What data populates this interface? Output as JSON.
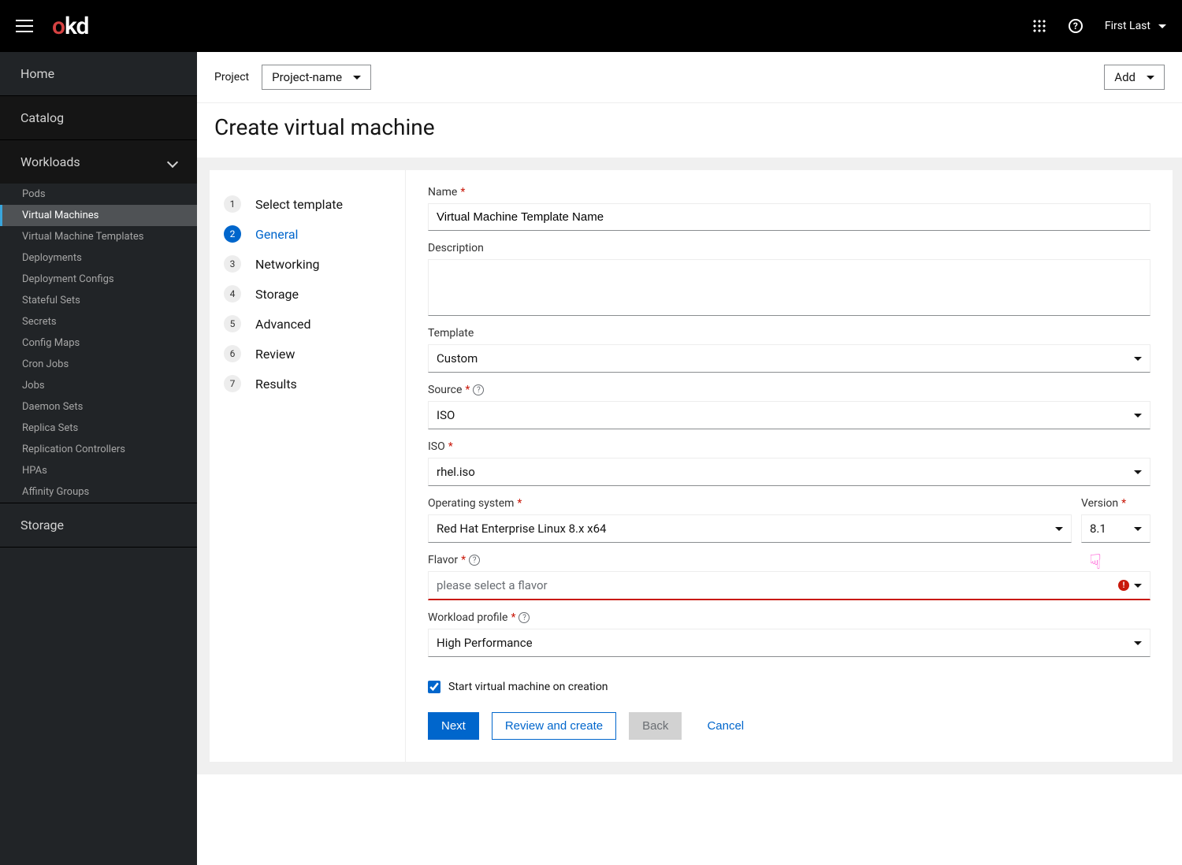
{
  "topbar": {
    "logo_o": "o",
    "logo_kd": "kd",
    "user": "First Last"
  },
  "sidebar": {
    "home": "Home",
    "catalog": "Catalog",
    "workloads": "Workloads",
    "items": [
      "Pods",
      "Virtual Machines",
      "Virtual Machine Templates",
      "Deployments",
      "Deployment Configs",
      "Stateful Sets",
      "Secrets",
      "Config Maps",
      "Cron Jobs",
      "Jobs",
      "Daemon Sets",
      "Replica Sets",
      "Replication Controllers",
      "HPAs",
      "Affinity Groups"
    ],
    "storage": "Storage"
  },
  "projbar": {
    "label": "Project",
    "value": "Project-name",
    "add": "Add"
  },
  "page": {
    "title": "Create virtual machine"
  },
  "wizard": {
    "steps": [
      "Select template",
      "General",
      "Networking",
      "Storage",
      "Advanced",
      "Review",
      "Results"
    ]
  },
  "form": {
    "name_label": "Name",
    "name_value": "Virtual Machine Template Name",
    "desc_label": "Description",
    "template_label": "Template",
    "template_value": "Custom",
    "source_label": "Source",
    "source_value": "ISO",
    "iso_label": "ISO",
    "iso_value": "rhel.iso",
    "os_label": "Operating system",
    "os_value": "Red Hat Enterprise Linux 8.x x64",
    "version_label": "Version",
    "version_value": "8.1",
    "flavor_label": "Flavor",
    "flavor_placeholder": "please select a flavor",
    "workload_label": "Workload profile",
    "workload_value": "High Performance",
    "checkbox_label": "Start virtual machine on creation"
  },
  "buttons": {
    "next": "Next",
    "review": "Review and create",
    "back": "Back",
    "cancel": "Cancel"
  }
}
